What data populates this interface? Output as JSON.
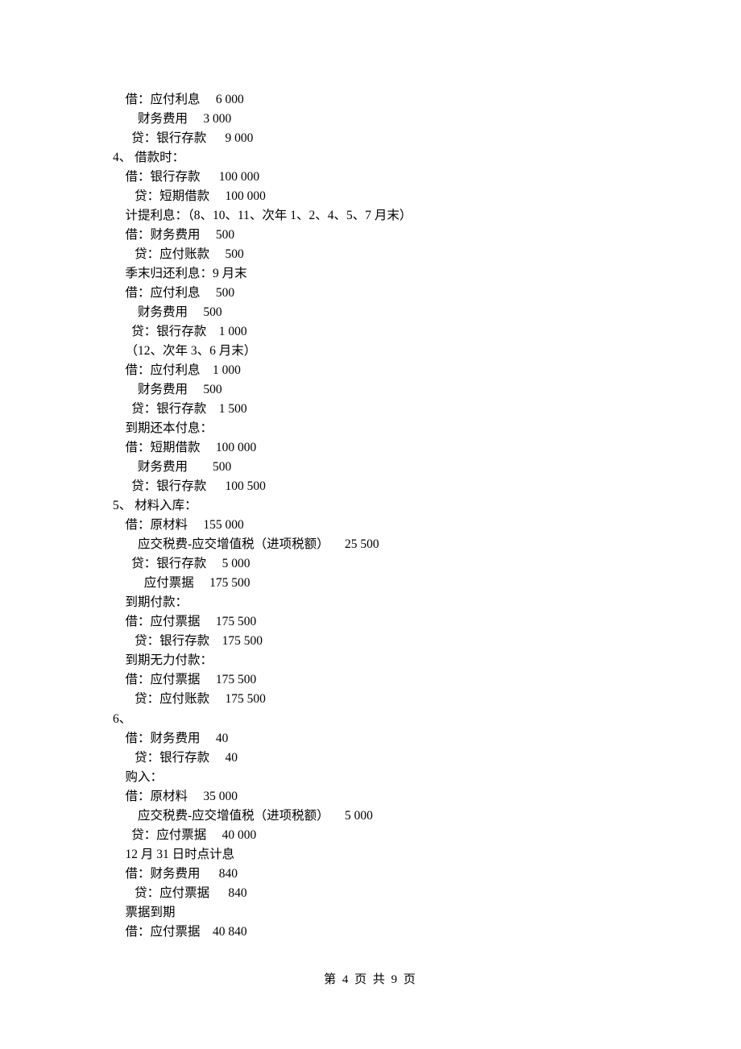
{
  "page": {
    "current": 4,
    "total": 9,
    "footer_text": "第 4 页 共 9 页"
  },
  "lines": [
    "    借：应付利息     6 000",
    "        财务费用     3 000",
    "      贷：银行存款      9 000",
    "4、 借款时：",
    "    借：银行存款      100 000",
    "       贷：短期借款     100 000",
    "    计提利息：（8、10、11、次年 1、2、4、5、7 月末）",
    "    借：财务费用     500",
    "       贷：应付账款     500",
    "    季末归还利息：9 月末",
    "    借：应付利息     500",
    "        财务费用     500",
    "      贷：银行存款    1 000",
    "    （12、次年 3、6 月末）",
    "    借：应付利息    1 000",
    "        财务费用     500",
    "      贷：银行存款    1 500",
    "    到期还本付息：",
    "    借：短期借款     100 000",
    "        财务费用        500",
    "      贷：银行存款      100 500",
    "5、 材料入库：",
    "    借：原材料     155 000",
    "        应交税费-应交增值税（进项税额）     25 500",
    "      贷：银行存款     5 000",
    "          应付票据     175 500",
    "    到期付款：",
    "    借：应付票据     175 500",
    "       贷：银行存款    175 500",
    "    到期无力付款：",
    "    借：应付票据     175 500",
    "       贷：应付账款     175 500",
    "6、",
    "    借：财务费用     40",
    "       贷：银行存款     40",
    "    购入：",
    "    借：原材料     35 000",
    "        应交税费-应交增值税（进项税额）     5 000",
    "      贷：应付票据     40 000",
    "    12 月 31 日时点计息",
    "    借：财务费用      840",
    "       贷：应付票据      840",
    "    票据到期",
    "    借：应付票据    40 840"
  ]
}
